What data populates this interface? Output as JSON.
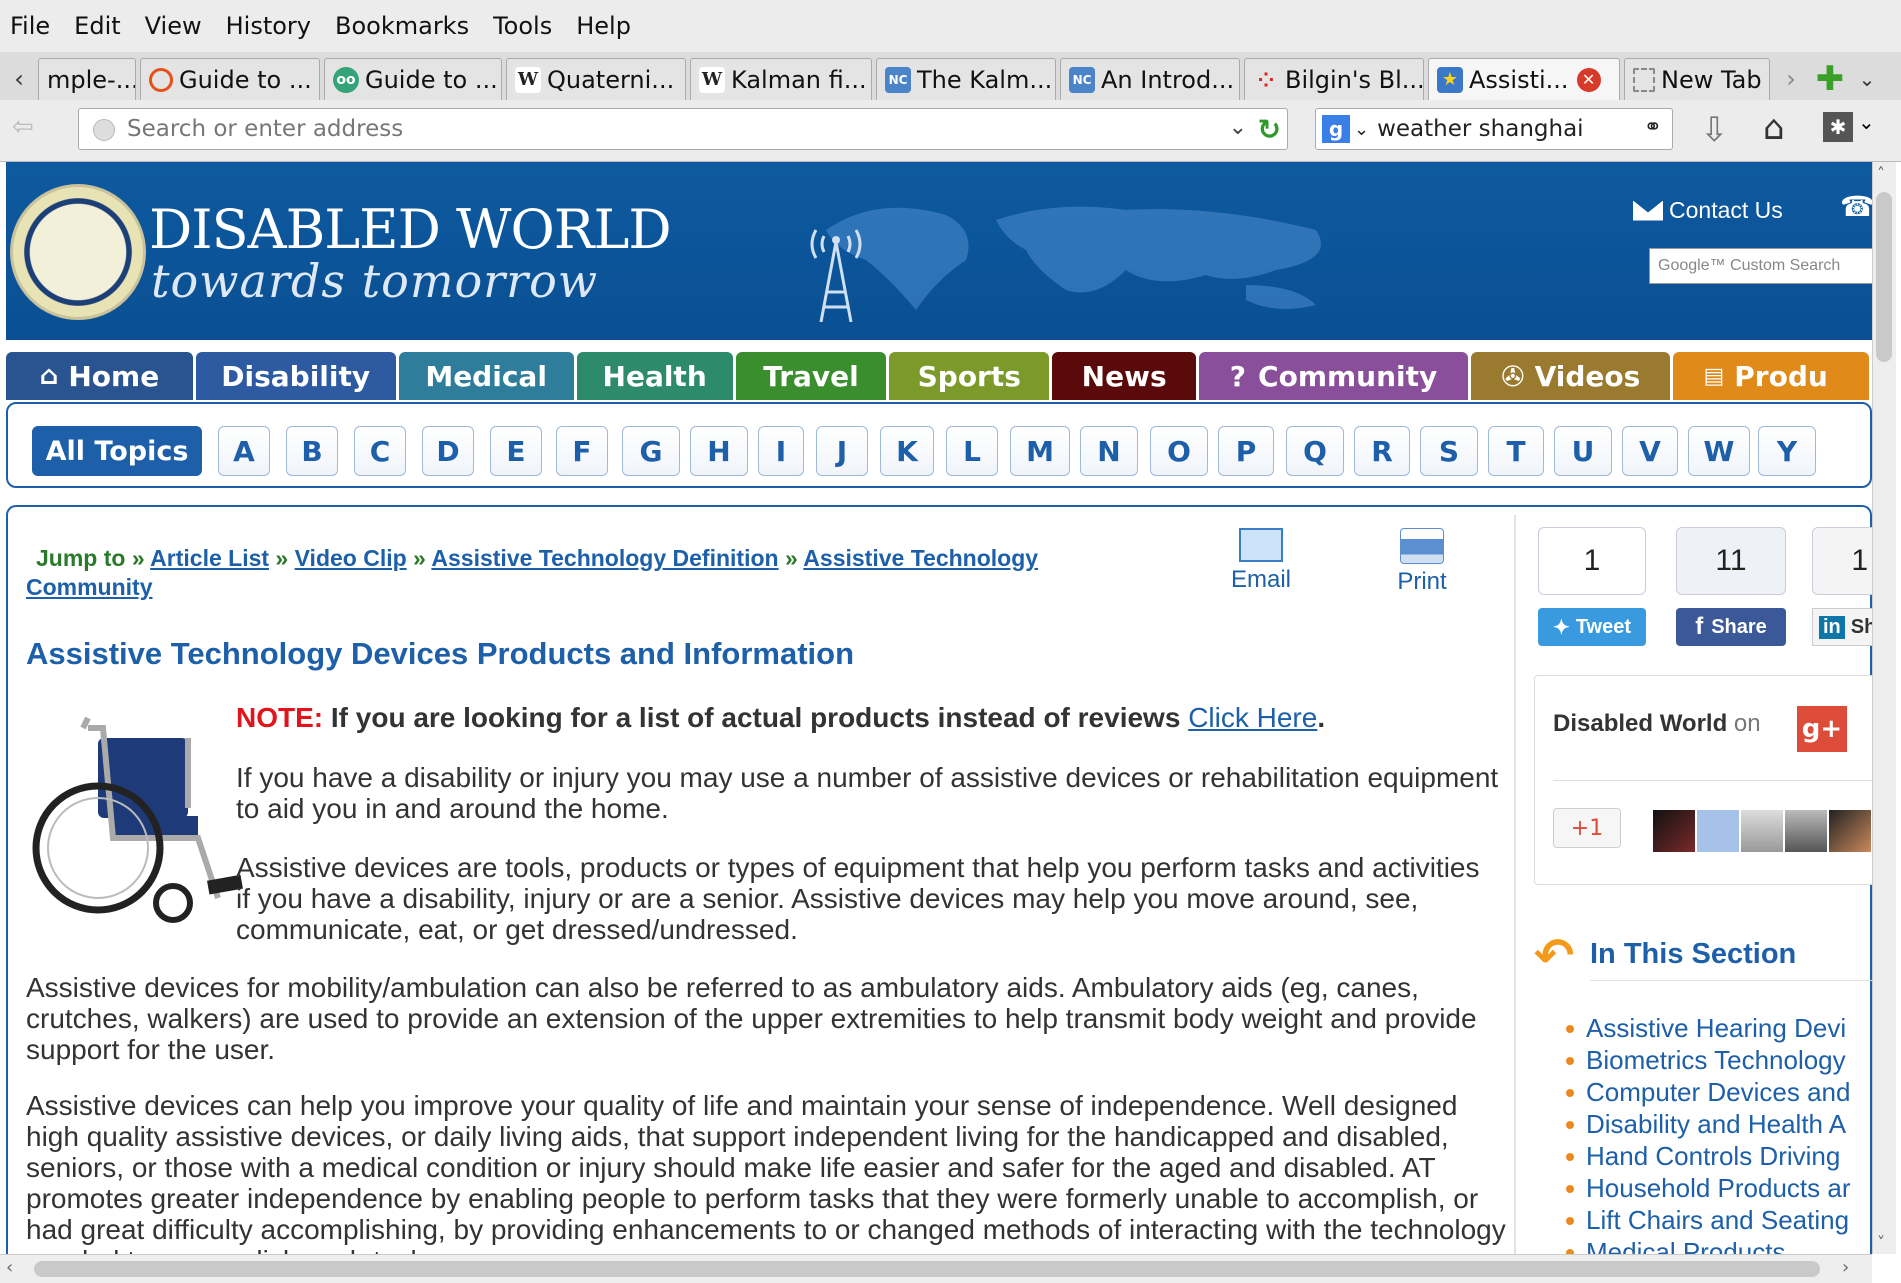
{
  "menu": [
    "File",
    "Edit",
    "View",
    "History",
    "Bookmarks",
    "Tools",
    "Help"
  ],
  "tabs": [
    {
      "label": "mple-...",
      "icon": "none"
    },
    {
      "label": "Guide to ...",
      "icon": "orange-ring"
    },
    {
      "label": "Guide to ...",
      "icon": "tripadvisor-owl"
    },
    {
      "label": "Quaterni...",
      "icon": "wikipedia"
    },
    {
      "label": "Kalman fi...",
      "icon": "wikipedia"
    },
    {
      "label": "The Kalm...",
      "icon": "unc-logo"
    },
    {
      "label": "An Introd...",
      "icon": "unc-logo"
    },
    {
      "label": "Bilgin's Bl...",
      "icon": "red-dots"
    },
    {
      "label": "Assisti...",
      "icon": "star-badge"
    },
    {
      "label": "New Tab",
      "icon": "blank-page"
    }
  ],
  "address": {
    "placeholder": "Search or enter address"
  },
  "search": {
    "value": "weather shanghai"
  },
  "site": {
    "title": "DISABLED WORLD",
    "subtitle": "towards tomorrow",
    "contact": "Contact Us",
    "google": "Google™ Custom Search"
  },
  "categories": [
    {
      "label": "Home",
      "color": "#2a5490"
    },
    {
      "label": "Disability",
      "color": "#2d5aa0"
    },
    {
      "label": "Medical",
      "color": "#2e7d9a"
    },
    {
      "label": "Health",
      "color": "#2d8a6a"
    },
    {
      "label": "Travel",
      "color": "#3b8e2e"
    },
    {
      "label": "Sports",
      "color": "#7b9a2a"
    },
    {
      "label": "News",
      "color": "#5a0a0a"
    },
    {
      "label": "Community",
      "color": "#8a4f9a"
    },
    {
      "label": "Videos",
      "color": "#9a7a2e"
    },
    {
      "label": "Produ",
      "color": "#e08a1a"
    }
  ],
  "alpha": {
    "all": "All Topics",
    "letters": [
      "A",
      "B",
      "C",
      "D",
      "E",
      "F",
      "G",
      "H",
      "I",
      "J",
      "K",
      "L",
      "M",
      "N",
      "O",
      "P",
      "Q",
      "R",
      "S",
      "T",
      "U",
      "V",
      "W",
      "Y"
    ]
  },
  "breadcrumb": {
    "jump": "Jump to",
    "items": [
      "Article List",
      "Video Clip",
      "Assistive Technology Definition",
      "Assistive Technology Community"
    ]
  },
  "actions": {
    "email": "Email",
    "print": "Print"
  },
  "article": {
    "heading": "Assistive Technology Devices Products and Information",
    "note_label": "NOTE:",
    "note_text": "If you are looking for a list of actual products instead of reviews",
    "note_link": "Click Here",
    "p1": "If you have a disability or injury you may use a number of assistive devices or rehabilitation equipment to aid you in and around the home.",
    "p2": "Assistive devices are tools, products or types of equipment that help you perform tasks and activities if you have a disability, injury or are a senior. Assistive devices may help you move around, see, communicate, eat, or get dressed/undressed.",
    "p3": "Assistive devices for mobility/ambulation can also be referred to as ambulatory aids. Ambulatory aids (eg, canes, crutches, walkers) are used to provide an extension of the upper extremities to help transmit body weight and provide support for the user.",
    "p4": "Assistive devices can help you improve your quality of life and maintain your sense of independence. Well designed high quality assistive devices, or daily living aids, that support independent living for the handicapped and disabled, seniors, or those with a medical condition or injury should make life easier and safer for the aged and disabled. AT promotes greater independence by enabling people to perform tasks that they were formerly unable to accomplish, or had great difficulty accomplishing, by providing enhancements to or changed methods of interacting with the technology needed to accomplish such tasks."
  },
  "social": {
    "tweet_count": "1",
    "tweet": "Tweet",
    "share_count": "11",
    "share": "Share",
    "in_count": "1",
    "in_label": "Sh"
  },
  "gplus": {
    "label": "Disabled World",
    "on": "on",
    "plus_one": "+1"
  },
  "section": {
    "title": "In This Section",
    "items": [
      "Assistive Hearing Devi",
      "Biometrics Technology",
      "Computer Devices and",
      "Disability and Health A",
      "Hand Controls Driving",
      "Household Products ar",
      "Lift Chairs and Seating",
      "Medical Products"
    ]
  }
}
